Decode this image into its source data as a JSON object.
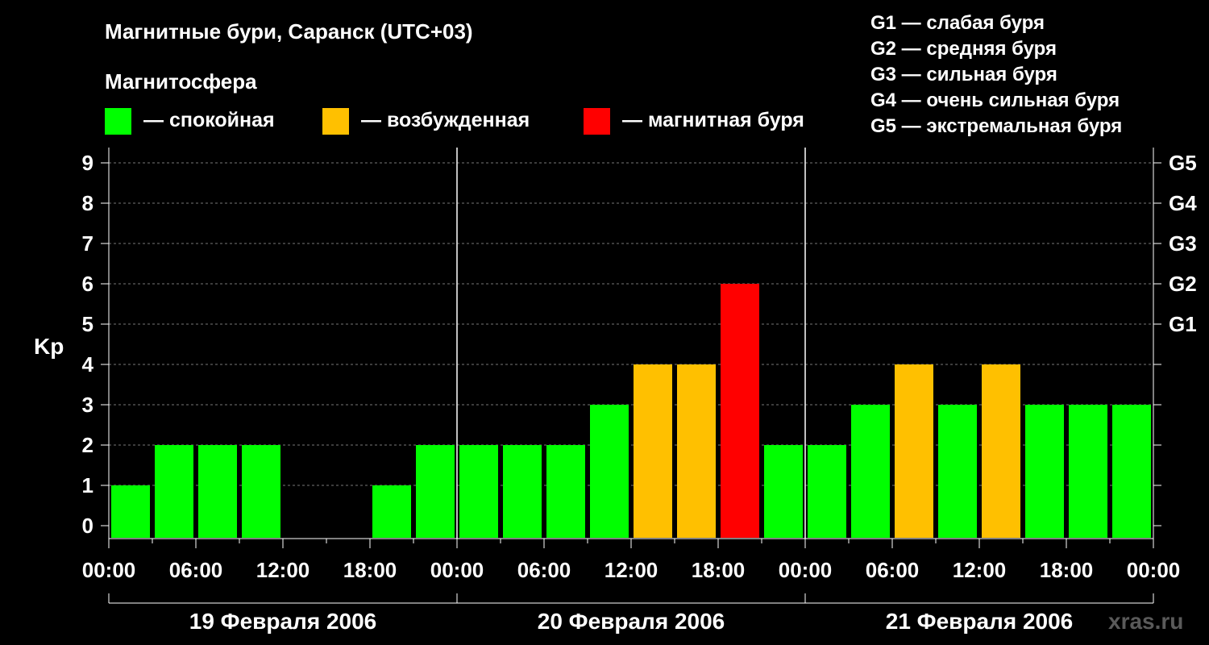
{
  "title": "Магнитные бури, Саранск (UTC+03)",
  "legend": {
    "title": "Магнитосфера",
    "items": [
      {
        "label": "— спокойная",
        "color": "#00ff00"
      },
      {
        "label": "— возбужденная",
        "color": "#ffc000"
      },
      {
        "label": "— магнитная буря",
        "color": "#ff0000"
      }
    ]
  },
  "g_scale": [
    "G1 — слабая буря",
    "G2 — средняя буря",
    "G3 — сильная буря",
    "G4 — очень сильная буря",
    "G5 — экстремальная буря"
  ],
  "watermark": "xras.ru",
  "chart_data": {
    "type": "bar",
    "ylabel": "Kp",
    "ylim": [
      0,
      9
    ],
    "y_ticks": [
      "0",
      "1",
      "2",
      "3",
      "4",
      "5",
      "6",
      "7",
      "8",
      "9"
    ],
    "right_axis_labels": [
      {
        "kp": 5,
        "label": "G1"
      },
      {
        "kp": 6,
        "label": "G2"
      },
      {
        "kp": 7,
        "label": "G3"
      },
      {
        "kp": 8,
        "label": "G4"
      },
      {
        "kp": 9,
        "label": "G5"
      }
    ],
    "x_tick_labels": [
      "00:00",
      "06:00",
      "12:00",
      "18:00",
      "00:00",
      "06:00",
      "12:00",
      "18:00",
      "00:00",
      "06:00",
      "12:00",
      "18:00",
      "00:00"
    ],
    "days": [
      "19 Февраля 2006",
      "20 Февраля 2006",
      "21 Февраля 2006"
    ],
    "interval_hours": 3,
    "values": [
      1,
      2,
      2,
      2,
      0,
      0,
      1,
      2,
      2,
      2,
      2,
      3,
      4,
      4,
      6,
      2,
      2,
      3,
      4,
      3,
      4,
      3,
      3,
      3
    ],
    "colors": {
      "quiet": "#00ff00",
      "active": "#ffc000",
      "storm": "#ff0000"
    },
    "grid": true
  }
}
